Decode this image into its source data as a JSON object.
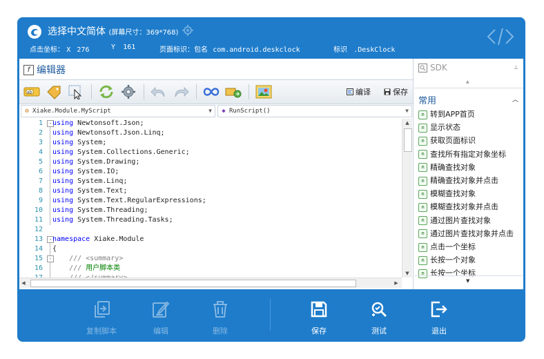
{
  "window": {
    "title": "选择中文简体",
    "dimensions": "(屏幕尺寸：369*768)"
  },
  "infobar": {
    "coord_label": "点击坐标：",
    "x_label": "X",
    "x_value": "276",
    "y_label": "Y",
    "y_value": "161",
    "page_label": "页面标识：包名",
    "package": "com.android.deskclock",
    "mark_label": "标识",
    "mark_value": ".DeskClock"
  },
  "editor": {
    "title": "编辑器",
    "compile_label": "编译",
    "save_label": "保存",
    "class_combo": "Xiake.Module.MyScript",
    "method_combo": "RunScript()",
    "lines": [
      {
        "n": "1",
        "fold": "-",
        "parts": [
          {
            "t": "using",
            "c": "kw"
          },
          {
            "t": " Newtonsoft.Json;",
            "c": ""
          }
        ]
      },
      {
        "n": "2",
        "fold": "",
        "parts": [
          {
            "t": "using",
            "c": "kw"
          },
          {
            "t": " Newtonsoft.Json.Linq;",
            "c": ""
          }
        ]
      },
      {
        "n": "3",
        "fold": "",
        "parts": [
          {
            "t": "using",
            "c": "kw"
          },
          {
            "t": " System;",
            "c": ""
          }
        ]
      },
      {
        "n": "4",
        "fold": "",
        "parts": [
          {
            "t": "using",
            "c": "kw"
          },
          {
            "t": " System.Collections.Generic;",
            "c": ""
          }
        ]
      },
      {
        "n": "5",
        "fold": "",
        "parts": [
          {
            "t": "using",
            "c": "kw"
          },
          {
            "t": " System.Drawing;",
            "c": ""
          }
        ]
      },
      {
        "n": "6",
        "fold": "",
        "parts": [
          {
            "t": "using",
            "c": "kw"
          },
          {
            "t": " System.IO;",
            "c": ""
          }
        ]
      },
      {
        "n": "7",
        "fold": "",
        "parts": [
          {
            "t": "using",
            "c": "kw"
          },
          {
            "t": " System.Linq;",
            "c": ""
          }
        ]
      },
      {
        "n": "8",
        "fold": "",
        "parts": [
          {
            "t": "using",
            "c": "kw"
          },
          {
            "t": " System.Text;",
            "c": ""
          }
        ]
      },
      {
        "n": "9",
        "fold": "",
        "parts": [
          {
            "t": "using",
            "c": "kw"
          },
          {
            "t": " System.Text.RegularExpressions;",
            "c": ""
          }
        ]
      },
      {
        "n": "10",
        "fold": "",
        "parts": [
          {
            "t": "using",
            "c": "kw"
          },
          {
            "t": " System.Threading;",
            "c": ""
          }
        ]
      },
      {
        "n": "11",
        "fold": "",
        "parts": [
          {
            "t": "using",
            "c": "kw"
          },
          {
            "t": " System.Threading.Tasks;",
            "c": ""
          }
        ]
      },
      {
        "n": "12",
        "fold": "",
        "parts": []
      },
      {
        "n": "13",
        "fold": "-",
        "parts": [
          {
            "t": "namespace",
            "c": "kw"
          },
          {
            "t": " Xiake.Module",
            "c": ""
          }
        ]
      },
      {
        "n": "14",
        "fold": "",
        "parts": [
          {
            "t": "{",
            "c": ""
          }
        ]
      },
      {
        "n": "15",
        "fold": "-",
        "parts": [
          {
            "t": "    /// <summary>",
            "c": "cm"
          }
        ]
      },
      {
        "n": "16",
        "fold": "",
        "parts": [
          {
            "t": "    /// ",
            "c": "cm"
          },
          {
            "t": "用户脚本类",
            "c": "cmz"
          }
        ]
      },
      {
        "n": "17",
        "fold": "",
        "parts": [
          {
            "t": "    /// </summary>",
            "c": "cm"
          }
        ]
      }
    ]
  },
  "sdk": {
    "title": "SDK",
    "category": "常用",
    "items": [
      "转到APP首页",
      "显示状态",
      "获取页面标识",
      "查找所有指定对象坐标",
      "精确查找对象",
      "精确查找对象并点击",
      "模糊查找对象",
      "模糊查找对象并点击",
      "通过图片查找对象",
      "通过图片查找对象并点击",
      "点击一个坐标",
      "长按一个对象",
      "长按一个坐标"
    ]
  },
  "bottom": {
    "copy": "复制脚本",
    "edit": "编辑",
    "delete": "删除",
    "save": "保存",
    "test": "测试",
    "exit": "退出"
  },
  "colors": {
    "brand": "#1e7ccb",
    "keyword": "#0000ff",
    "comment": "#808080",
    "comment_zh": "#008000",
    "line_number": "#2b91af"
  }
}
